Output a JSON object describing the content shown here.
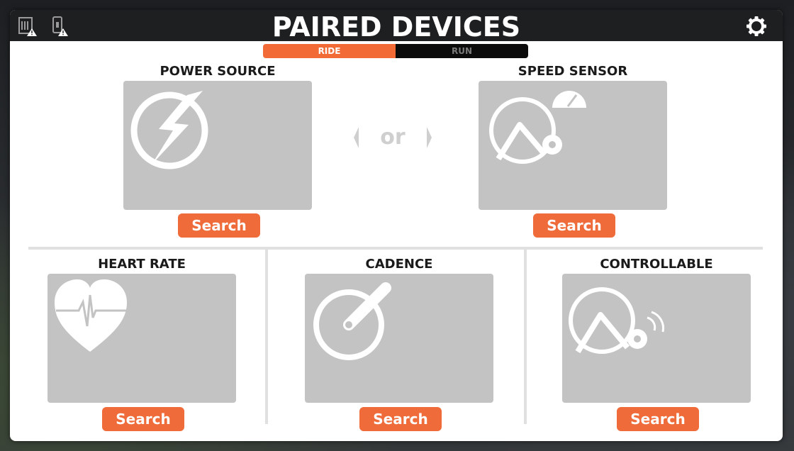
{
  "header": {
    "title": "PAIRED DEVICES"
  },
  "toggle": {
    "ride_label": "RIDE",
    "run_label": "RUN",
    "active": "RIDE"
  },
  "separator_text": "or",
  "devices": {
    "power_source": {
      "label": "POWER SOURCE",
      "button": "Search"
    },
    "speed_sensor": {
      "label": "SPEED SENSOR",
      "button": "Search"
    },
    "heart_rate": {
      "label": "HEART RATE",
      "button": "Search"
    },
    "cadence": {
      "label": "CADENCE",
      "button": "Search"
    },
    "controllable": {
      "label": "CONTROLLABLE",
      "button": "Search"
    }
  },
  "colors": {
    "accent": "#ef6b3a",
    "tile": "#c3c3c3",
    "header_bg": "#1e1f21"
  }
}
